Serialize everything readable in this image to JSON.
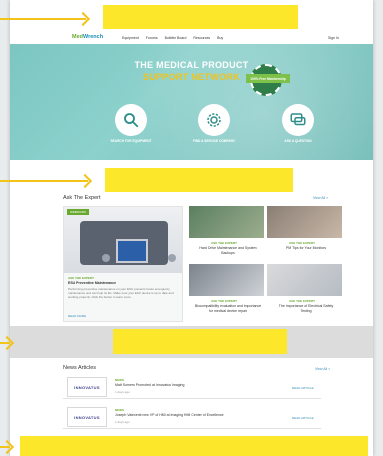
{
  "header": {
    "logo_main": "Med",
    "logo_accent": "Wrench",
    "nav": [
      "Equipment",
      "Forums",
      "Bulletin Board",
      "Resources",
      "Buy"
    ],
    "signin": "Sign In"
  },
  "hero": {
    "title_line1": "THE MEDICAL PRODUCT",
    "title_line2": "SUPPORT NETWORK",
    "badge_text": "100% Free Membership",
    "actions": [
      {
        "label": "SEARCH FOR EQUIPMENT",
        "icon": "search-icon"
      },
      {
        "label": "FIND A SERVICE COMPANY",
        "icon": "gear-icon"
      },
      {
        "label": "ASK A QUESTION",
        "icon": "chat-icon"
      }
    ]
  },
  "ask_expert": {
    "title": "Ask The Expert",
    "view_all": "View All >",
    "featured": {
      "tag": "WEBINARS",
      "category": "ASK THE EXPERT",
      "title": "ESU Preventive Maintenance",
      "description": "Performing preventive maintenance on your ESU prevents future emergency maintenance and can help its life. Make sure your ESU device is up to date and working properly. Click the button to learn more.",
      "read_more": "READ MORE"
    },
    "cards": [
      {
        "category": "ASK THE EXPERT",
        "title": "Hard Drive Maintenance and System Backups"
      },
      {
        "category": "ASK THE EXPERT",
        "title": "PM Tips for Your Monitors"
      },
      {
        "category": "ASK THE EXPERT",
        "title": "Biocompatibility evaluation and importance for medical device repair"
      },
      {
        "category": "ASK THE EXPERT",
        "title": "The Importance of Electrical Safety Testing"
      }
    ]
  },
  "news": {
    "title": "News Articles",
    "view_all": "View All >",
    "items": [
      {
        "logo": "INNOVATUS",
        "category": "NEWS",
        "headline": "Matt Somers Promoted at Innovatus Imaging",
        "date": "1 days ago",
        "read": "READ ARTICLE"
      },
      {
        "logo": "INNOVATUS",
        "category": "NEWS",
        "headline": "Joseph Valecenti new VP of HMI at Imaging HMI Center of Excellence",
        "date": "1 days ago",
        "read": "READ ARTICLE"
      }
    ]
  },
  "colors": {
    "accent_green": "#6aa92f",
    "accent_blue": "#3a8fb8",
    "hero_teal": "#7cc6c2",
    "highlight_yellow": "#fde72a"
  }
}
